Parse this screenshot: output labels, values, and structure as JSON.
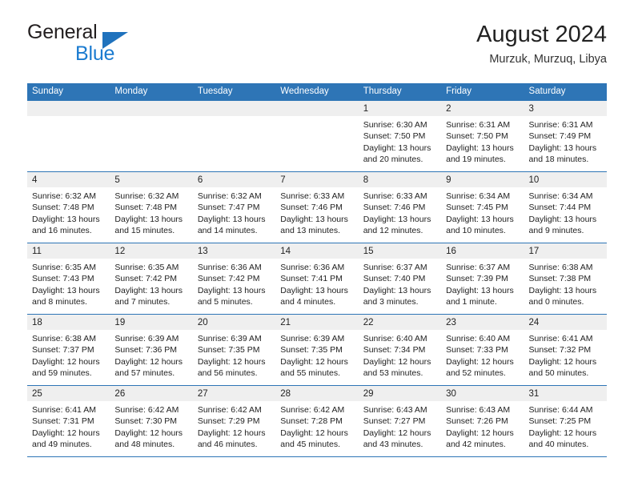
{
  "brand": {
    "name_part1": "General",
    "name_part2": "Blue"
  },
  "header": {
    "title": "August 2024",
    "subtitle": "Murzuk, Murzuq, Libya"
  },
  "colors": {
    "header_blue": "#2e75b6",
    "brand_blue": "#1b7bd0",
    "day_band": "#efefef",
    "text": "#222222"
  },
  "weekdays": [
    "Sunday",
    "Monday",
    "Tuesday",
    "Wednesday",
    "Thursday",
    "Friday",
    "Saturday"
  ],
  "weeks": [
    [
      {
        "day": "",
        "sunrise": "",
        "sunset": "",
        "daylight1": "",
        "daylight2": ""
      },
      {
        "day": "",
        "sunrise": "",
        "sunset": "",
        "daylight1": "",
        "daylight2": ""
      },
      {
        "day": "",
        "sunrise": "",
        "sunset": "",
        "daylight1": "",
        "daylight2": ""
      },
      {
        "day": "",
        "sunrise": "",
        "sunset": "",
        "daylight1": "",
        "daylight2": ""
      },
      {
        "day": "1",
        "sunrise": "Sunrise: 6:30 AM",
        "sunset": "Sunset: 7:50 PM",
        "daylight1": "Daylight: 13 hours",
        "daylight2": "and 20 minutes."
      },
      {
        "day": "2",
        "sunrise": "Sunrise: 6:31 AM",
        "sunset": "Sunset: 7:50 PM",
        "daylight1": "Daylight: 13 hours",
        "daylight2": "and 19 minutes."
      },
      {
        "day": "3",
        "sunrise": "Sunrise: 6:31 AM",
        "sunset": "Sunset: 7:49 PM",
        "daylight1": "Daylight: 13 hours",
        "daylight2": "and 18 minutes."
      }
    ],
    [
      {
        "day": "4",
        "sunrise": "Sunrise: 6:32 AM",
        "sunset": "Sunset: 7:48 PM",
        "daylight1": "Daylight: 13 hours",
        "daylight2": "and 16 minutes."
      },
      {
        "day": "5",
        "sunrise": "Sunrise: 6:32 AM",
        "sunset": "Sunset: 7:48 PM",
        "daylight1": "Daylight: 13 hours",
        "daylight2": "and 15 minutes."
      },
      {
        "day": "6",
        "sunrise": "Sunrise: 6:32 AM",
        "sunset": "Sunset: 7:47 PM",
        "daylight1": "Daylight: 13 hours",
        "daylight2": "and 14 minutes."
      },
      {
        "day": "7",
        "sunrise": "Sunrise: 6:33 AM",
        "sunset": "Sunset: 7:46 PM",
        "daylight1": "Daylight: 13 hours",
        "daylight2": "and 13 minutes."
      },
      {
        "day": "8",
        "sunrise": "Sunrise: 6:33 AM",
        "sunset": "Sunset: 7:46 PM",
        "daylight1": "Daylight: 13 hours",
        "daylight2": "and 12 minutes."
      },
      {
        "day": "9",
        "sunrise": "Sunrise: 6:34 AM",
        "sunset": "Sunset: 7:45 PM",
        "daylight1": "Daylight: 13 hours",
        "daylight2": "and 10 minutes."
      },
      {
        "day": "10",
        "sunrise": "Sunrise: 6:34 AM",
        "sunset": "Sunset: 7:44 PM",
        "daylight1": "Daylight: 13 hours",
        "daylight2": "and 9 minutes."
      }
    ],
    [
      {
        "day": "11",
        "sunrise": "Sunrise: 6:35 AM",
        "sunset": "Sunset: 7:43 PM",
        "daylight1": "Daylight: 13 hours",
        "daylight2": "and 8 minutes."
      },
      {
        "day": "12",
        "sunrise": "Sunrise: 6:35 AM",
        "sunset": "Sunset: 7:42 PM",
        "daylight1": "Daylight: 13 hours",
        "daylight2": "and 7 minutes."
      },
      {
        "day": "13",
        "sunrise": "Sunrise: 6:36 AM",
        "sunset": "Sunset: 7:42 PM",
        "daylight1": "Daylight: 13 hours",
        "daylight2": "and 5 minutes."
      },
      {
        "day": "14",
        "sunrise": "Sunrise: 6:36 AM",
        "sunset": "Sunset: 7:41 PM",
        "daylight1": "Daylight: 13 hours",
        "daylight2": "and 4 minutes."
      },
      {
        "day": "15",
        "sunrise": "Sunrise: 6:37 AM",
        "sunset": "Sunset: 7:40 PM",
        "daylight1": "Daylight: 13 hours",
        "daylight2": "and 3 minutes."
      },
      {
        "day": "16",
        "sunrise": "Sunrise: 6:37 AM",
        "sunset": "Sunset: 7:39 PM",
        "daylight1": "Daylight: 13 hours",
        "daylight2": "and 1 minute."
      },
      {
        "day": "17",
        "sunrise": "Sunrise: 6:38 AM",
        "sunset": "Sunset: 7:38 PM",
        "daylight1": "Daylight: 13 hours",
        "daylight2": "and 0 minutes."
      }
    ],
    [
      {
        "day": "18",
        "sunrise": "Sunrise: 6:38 AM",
        "sunset": "Sunset: 7:37 PM",
        "daylight1": "Daylight: 12 hours",
        "daylight2": "and 59 minutes."
      },
      {
        "day": "19",
        "sunrise": "Sunrise: 6:39 AM",
        "sunset": "Sunset: 7:36 PM",
        "daylight1": "Daylight: 12 hours",
        "daylight2": "and 57 minutes."
      },
      {
        "day": "20",
        "sunrise": "Sunrise: 6:39 AM",
        "sunset": "Sunset: 7:35 PM",
        "daylight1": "Daylight: 12 hours",
        "daylight2": "and 56 minutes."
      },
      {
        "day": "21",
        "sunrise": "Sunrise: 6:39 AM",
        "sunset": "Sunset: 7:35 PM",
        "daylight1": "Daylight: 12 hours",
        "daylight2": "and 55 minutes."
      },
      {
        "day": "22",
        "sunrise": "Sunrise: 6:40 AM",
        "sunset": "Sunset: 7:34 PM",
        "daylight1": "Daylight: 12 hours",
        "daylight2": "and 53 minutes."
      },
      {
        "day": "23",
        "sunrise": "Sunrise: 6:40 AM",
        "sunset": "Sunset: 7:33 PM",
        "daylight1": "Daylight: 12 hours",
        "daylight2": "and 52 minutes."
      },
      {
        "day": "24",
        "sunrise": "Sunrise: 6:41 AM",
        "sunset": "Sunset: 7:32 PM",
        "daylight1": "Daylight: 12 hours",
        "daylight2": "and 50 minutes."
      }
    ],
    [
      {
        "day": "25",
        "sunrise": "Sunrise: 6:41 AM",
        "sunset": "Sunset: 7:31 PM",
        "daylight1": "Daylight: 12 hours",
        "daylight2": "and 49 minutes."
      },
      {
        "day": "26",
        "sunrise": "Sunrise: 6:42 AM",
        "sunset": "Sunset: 7:30 PM",
        "daylight1": "Daylight: 12 hours",
        "daylight2": "and 48 minutes."
      },
      {
        "day": "27",
        "sunrise": "Sunrise: 6:42 AM",
        "sunset": "Sunset: 7:29 PM",
        "daylight1": "Daylight: 12 hours",
        "daylight2": "and 46 minutes."
      },
      {
        "day": "28",
        "sunrise": "Sunrise: 6:42 AM",
        "sunset": "Sunset: 7:28 PM",
        "daylight1": "Daylight: 12 hours",
        "daylight2": "and 45 minutes."
      },
      {
        "day": "29",
        "sunrise": "Sunrise: 6:43 AM",
        "sunset": "Sunset: 7:27 PM",
        "daylight1": "Daylight: 12 hours",
        "daylight2": "and 43 minutes."
      },
      {
        "day": "30",
        "sunrise": "Sunrise: 6:43 AM",
        "sunset": "Sunset: 7:26 PM",
        "daylight1": "Daylight: 12 hours",
        "daylight2": "and 42 minutes."
      },
      {
        "day": "31",
        "sunrise": "Sunrise: 6:44 AM",
        "sunset": "Sunset: 7:25 PM",
        "daylight1": "Daylight: 12 hours",
        "daylight2": "and 40 minutes."
      }
    ]
  ]
}
